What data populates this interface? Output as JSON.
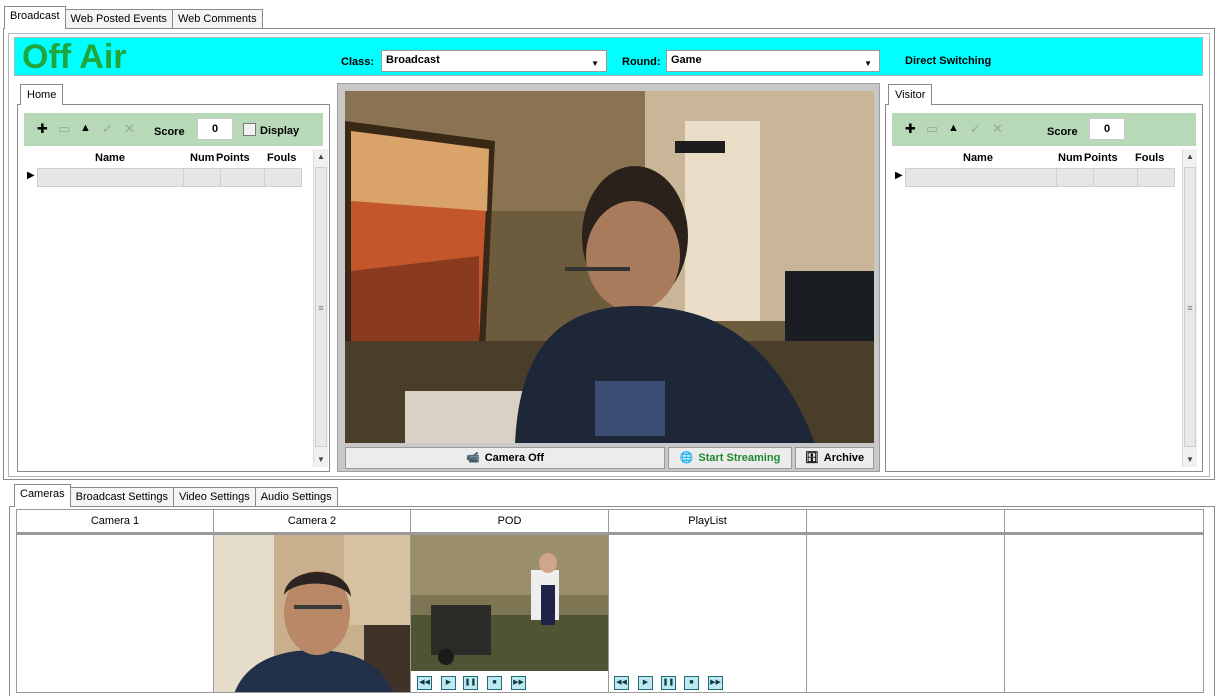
{
  "main_tabs": [
    "Broadcast",
    "Web Posted Events",
    "Web Comments"
  ],
  "header": {
    "status": "Off Air",
    "class_label": "Class:",
    "class_value": "Broadcast",
    "round_label": "Round:",
    "round_value": "Game",
    "direct_switching": "Direct Switching"
  },
  "home": {
    "tab": "Home",
    "score_label": "Score",
    "score": "0",
    "display_label": "Display",
    "columns": [
      "Name",
      "Num",
      "Points",
      "Fouls"
    ]
  },
  "visitor": {
    "tab": "Visitor",
    "score_label": "Score",
    "score": "0",
    "columns": [
      "Name",
      "Num",
      "Points",
      "Fouls"
    ]
  },
  "video_controls": {
    "camera_off": "Camera Off",
    "start_streaming": "Start Streaming",
    "archive": "Archive"
  },
  "bottom_tabs": [
    "Cameras",
    "Broadcast Settings",
    "Video Settings",
    "Audio Settings"
  ],
  "camera_columns": [
    "Camera 1",
    "Camera 2",
    "POD",
    "PlayList",
    "",
    ""
  ],
  "icons": {
    "toolbar": [
      "plus-icon",
      "minus-icon",
      "up-arrow-icon",
      "check-icon",
      "cancel-icon"
    ],
    "media": [
      "rewind-icon",
      "play-icon",
      "pause-icon",
      "stop-icon",
      "forward-icon"
    ]
  },
  "colors": {
    "header_bg": "#00ffff",
    "off_air_text": "#21a63b",
    "toolbar_bg": "#b7d9b7",
    "streaming_text": "#1f8a2f"
  }
}
